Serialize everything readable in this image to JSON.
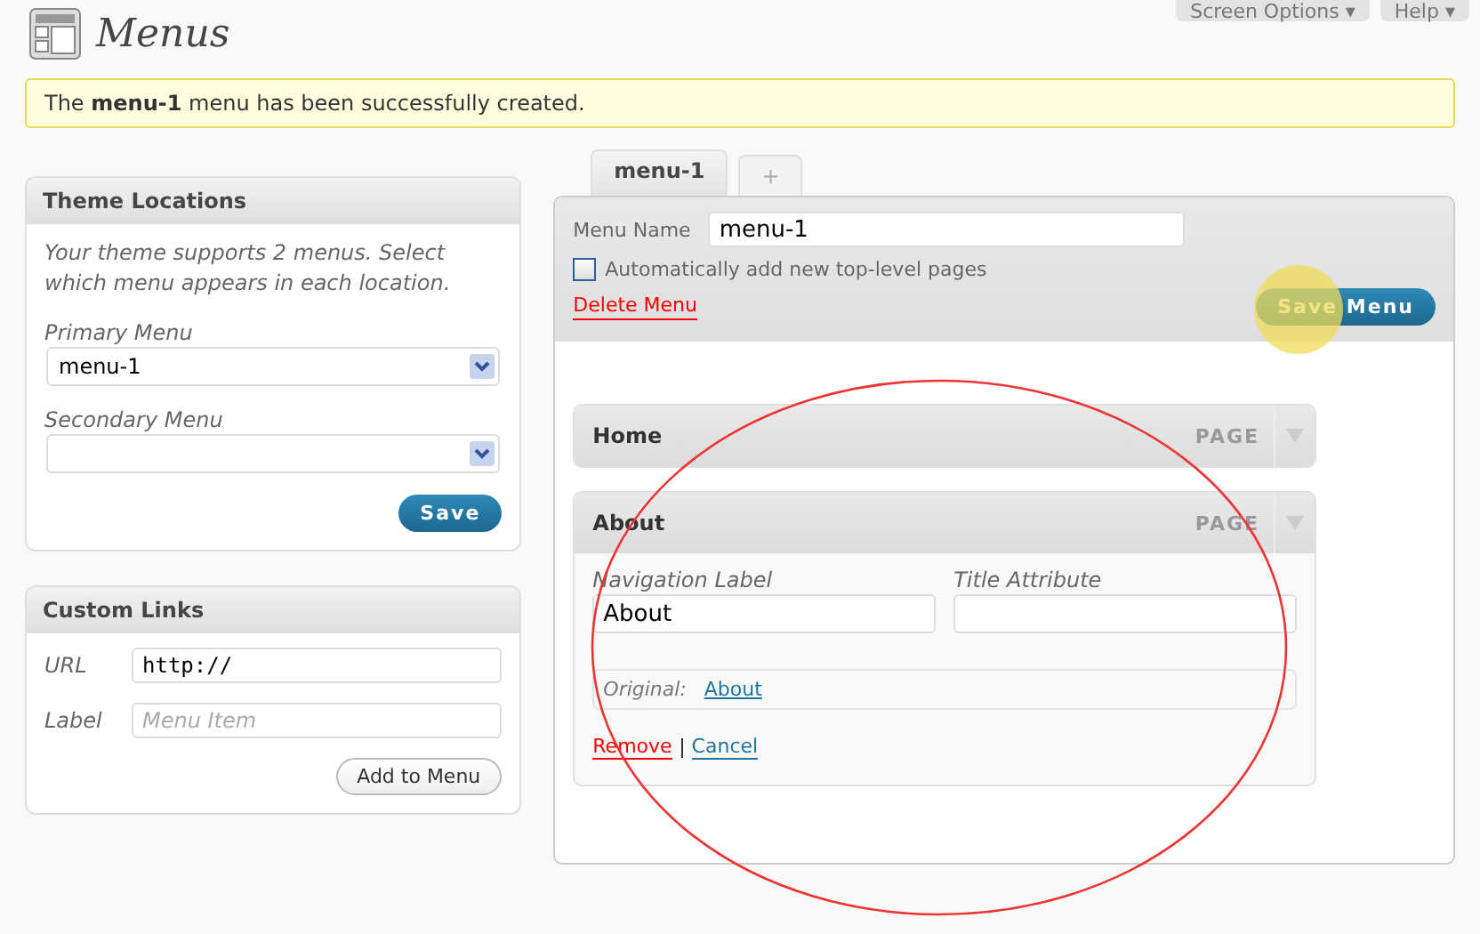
{
  "header": {
    "title": "Menus",
    "buttons": [
      "Screen Options ▾",
      "Help ▾"
    ]
  },
  "notice": "The **menu-1** menu has been successfully created.",
  "tabs": [
    {
      "label": "menu-1",
      "selected": true
    },
    {
      "label": "+",
      "selected": false
    }
  ],
  "theme_locations": {
    "title": "Theme Locations",
    "description": "Your theme supports 2 menus. Select which menu appears in each location.",
    "selects": [
      {
        "label": "Primary Menu",
        "value": "menu-1"
      },
      {
        "label": "Secondary Menu"
      }
    ],
    "button": "Save"
  },
  "custom_links": {
    "title": "Custom Links",
    "fields": [
      {
        "label": "URL",
        "value": "http://"
      },
      {
        "label": "Label",
        "placeholder": "Menu Item"
      }
    ],
    "button": "Add to Menu"
  },
  "menu_editor": {
    "name_label": "Menu Name",
    "name_value": "menu-1",
    "auto_add": {
      "label": "Automatically add new top-level pages",
      "checked": false
    },
    "delete": "Delete Menu",
    "save": "Save Menu",
    "items": [
      {
        "title": "Home",
        "type": "PAGE",
        "expanded": false
      },
      {
        "title": "About",
        "type": "PAGE",
        "expanded": true,
        "nav_label": "Navigation Label",
        "nav_value": "About",
        "title_attr_label": "Title Attribute",
        "original_label": "Original:",
        "original_link": "About",
        "remove": "Remove",
        "cancel": "Cancel"
      }
    ]
  }
}
